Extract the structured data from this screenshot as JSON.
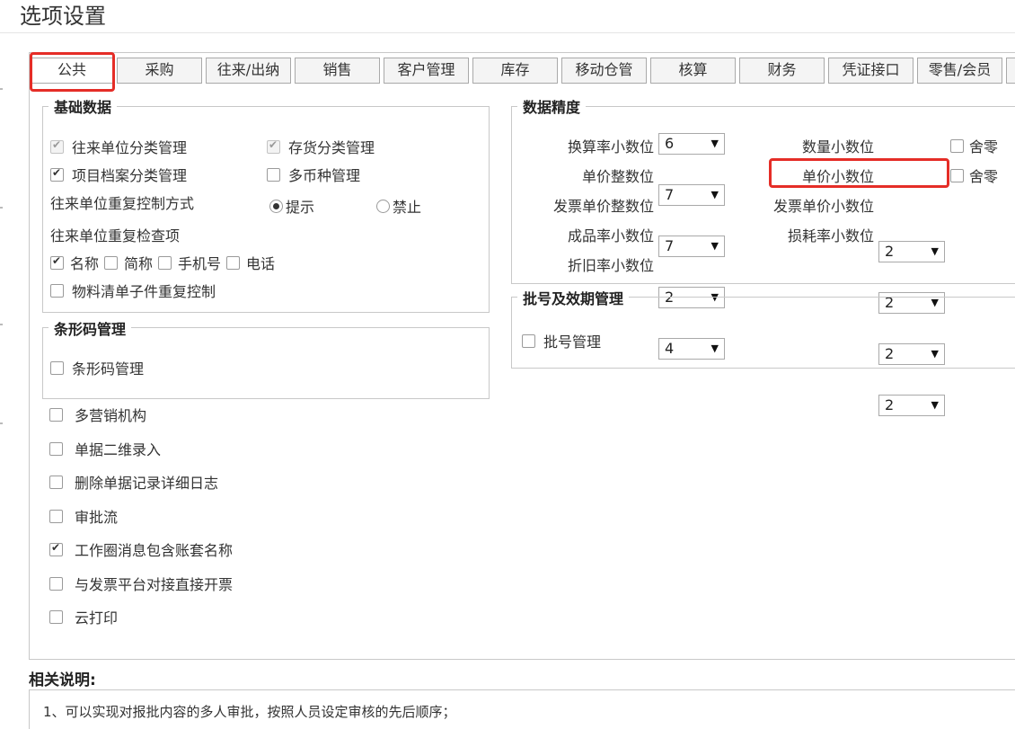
{
  "window": {
    "title": "选项设置"
  },
  "tabs": [
    {
      "label": "公共",
      "active": true
    },
    {
      "label": "采购"
    },
    {
      "label": "往来/出纳"
    },
    {
      "label": "销售"
    },
    {
      "label": "客户管理"
    },
    {
      "label": "库存"
    },
    {
      "label": "移动仓管"
    },
    {
      "label": "核算"
    },
    {
      "label": "财务"
    },
    {
      "label": "凭证接口"
    },
    {
      "label": "零售/会员"
    }
  ],
  "basic": {
    "legend": "基础数据",
    "party_category": {
      "label": "往来单位分类管理",
      "checked": true,
      "disabled": true
    },
    "stock_category": {
      "label": "存货分类管理",
      "checked": true,
      "disabled": true
    },
    "project_category": {
      "label": "项目档案分类管理",
      "checked": true
    },
    "multi_currency": {
      "label": "多币种管理",
      "checked": false
    },
    "dup_control_label": "往来单位重复控制方式",
    "radio_prompt": {
      "label": "提示",
      "checked": true
    },
    "radio_forbid": {
      "label": "禁止",
      "checked": false
    },
    "dup_check_label": "往来单位重复检查项",
    "check_name": {
      "label": "名称",
      "checked": true
    },
    "check_short": {
      "label": "简称",
      "checked": false
    },
    "check_mobile": {
      "label": "手机号",
      "checked": false
    },
    "check_phone": {
      "label": "电话",
      "checked": false
    },
    "bom_dup": {
      "label": "物料清单子件重复控制",
      "checked": false
    }
  },
  "barcode": {
    "legend": "条形码管理",
    "barcode_mgmt": {
      "label": "条形码管理",
      "checked": false
    }
  },
  "precision": {
    "legend": "数据精度",
    "conv_rate": {
      "label": "换算率小数位",
      "value": "6"
    },
    "price_int": {
      "label": "单价整数位",
      "value": "7"
    },
    "invoice_price_int": {
      "label": "发票单价整数位",
      "value": "7"
    },
    "yield_rate": {
      "label": "成品率小数位",
      "value": "2"
    },
    "depr_rate": {
      "label": "折旧率小数位",
      "value": "4"
    },
    "qty_dec": {
      "label": "数量小数位",
      "value": "2",
      "round_label": "舍零"
    },
    "price_dec": {
      "label": "单价小数位",
      "value": "2",
      "round_label": "舍零"
    },
    "invoice_price_dec": {
      "label": "发票单价小数位",
      "value": "2"
    },
    "loss_rate": {
      "label": "损耗率小数位",
      "value": "2"
    }
  },
  "batch": {
    "legend": "批号及效期管理",
    "batch_mgmt": {
      "label": "批号管理",
      "checked": false
    }
  },
  "options": [
    {
      "label": "多营销机构",
      "checked": false
    },
    {
      "label": "单据二维录入",
      "checked": false
    },
    {
      "label": "删除单据记录详细日志",
      "checked": false
    },
    {
      "label": "审批流",
      "checked": false
    },
    {
      "label": "工作圈消息包含账套名称",
      "checked": true
    },
    {
      "label": "与发票平台对接直接开票",
      "checked": false
    },
    {
      "label": "云打印",
      "checked": false
    }
  ],
  "description": {
    "title": "相关说明:",
    "text": "1、可以实现对报批内容的多人审批，按照人员设定审核的先后顺序；"
  },
  "colors": {
    "highlight": "#e52d27",
    "border": "#c8c8c8",
    "tab_bg": "#f4f4f4"
  }
}
